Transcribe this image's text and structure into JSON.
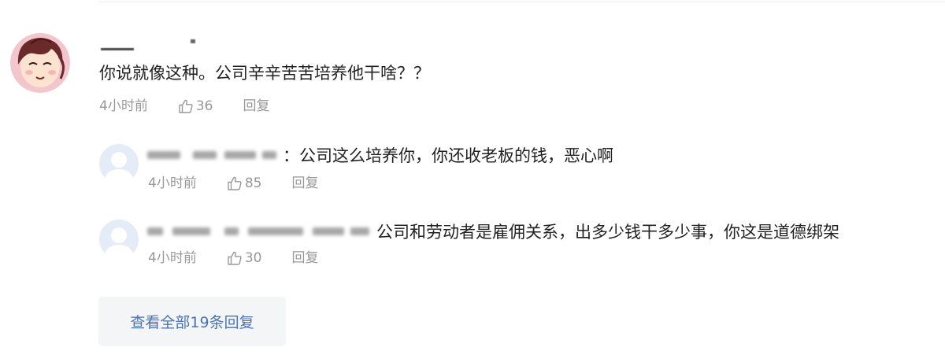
{
  "main_comment": {
    "text": "你说就像这种。公司辛辛苦苦培养他干啥？？",
    "time": "4小时前",
    "likes": "36",
    "reply_label": "回复"
  },
  "replies": [
    {
      "text": "：公司这么培养你，你还收老板的钱，恶心啊",
      "time": "4小时前",
      "likes": "85",
      "reply_label": "回复"
    },
    {
      "text": "公司和劳动者是雇佣关系，出多少钱干多少事，你这是道德绑架",
      "time": "4小时前",
      "likes": "30",
      "reply_label": "回复"
    }
  ],
  "view_all_label": "查看全部19条回复",
  "colors": {
    "text": "#222222",
    "meta": "#999999",
    "link": "#4a73b4",
    "view_all_bg": "#f4f5f6",
    "default_avatar": "#e4ecf8"
  },
  "icons": {
    "like": "thumbs-up-icon",
    "default_avatar": "user-silhouette-icon"
  }
}
